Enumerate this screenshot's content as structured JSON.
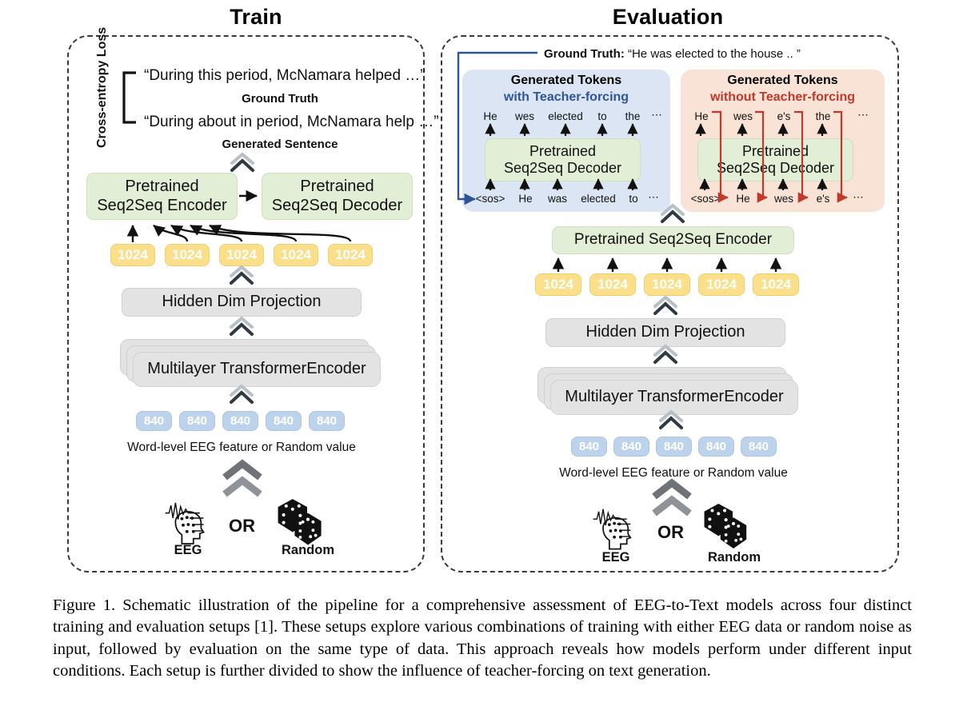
{
  "figure": {
    "caption": "Figure 1. Schematic illustration of the pipeline for a comprehensive assessment of EEG-to-Text models across four distinct training and evaluation setups [1]. These setups explore various combinations of training with either EEG data or random noise as input, followed by evaluation on the same type of data. This approach reveals how models perform under different input conditions. Each setup is further divided to show the influence of teacher-forcing on text generation."
  },
  "colors": {
    "green_box": "#e2eed6",
    "grey_box": "#e3e3e3",
    "token_1024": "#fbdf8a",
    "token_840": "#bdd3ec",
    "teacher_forcing_panel": "#dbe5f3",
    "teacher_forcing_text": "#2f5597",
    "no_teacher_forcing_panel": "#f9e2d6",
    "no_teacher_forcing_text": "#c0392b",
    "ground_truth_arrow": "#2f5597"
  },
  "train": {
    "title": "Train",
    "loss_label": "Cross-entropy Loss",
    "ground_truth_sentence": "“During this period, McNamara helped …”",
    "ground_truth_caption": "Ground Truth",
    "generated_sentence": "“During about in period, McNamara help …”",
    "generated_caption": "Generated Sentence",
    "encoder_line1": "Pretrained",
    "encoder_line2": "Seq2Seq Encoder",
    "decoder_line1": "Pretrained",
    "decoder_line2": "Seq2Seq Decoder",
    "tokens_1024": [
      "1024",
      "1024",
      "1024",
      "1024",
      "1024"
    ],
    "hidden_projection": "Hidden Dim Projection",
    "transformer_encoder": "Multilayer TransformerEncoder",
    "tokens_840": [
      "840",
      "840",
      "840",
      "840",
      "840"
    ],
    "input_caption": "Word-level EEG feature or Random value",
    "or_label": "OR",
    "eeg_label": "EEG",
    "random_label": "Random"
  },
  "evaluation": {
    "title": "Evaluation",
    "ground_truth_prefix": "Ground Truth:",
    "ground_truth_text": "“He was elected to the house .. ”",
    "teacher_forcing": {
      "heading": "Generated Tokens",
      "subheading": "with Teacher-forcing",
      "output_tokens": [
        "He",
        "wes",
        "elected",
        "to",
        "the",
        "⋯"
      ],
      "decoder_line1": "Pretrained",
      "decoder_line2": "Seq2Seq Decoder",
      "input_tokens": [
        "<sos>",
        "He",
        "was",
        "elected",
        "to",
        "⋯"
      ]
    },
    "no_teacher_forcing": {
      "heading": "Generated Tokens",
      "subheading": "without Teacher-forcing",
      "output_tokens": [
        "He",
        "wes",
        "e's",
        "the",
        "⋯"
      ],
      "decoder_line1": "Pretrained",
      "decoder_line2": "Seq2Seq Decoder",
      "input_tokens": [
        "<sos>",
        "He",
        "wes",
        "e's",
        "⋯"
      ]
    },
    "encoder": "Pretrained Seq2Seq Encoder",
    "tokens_1024": [
      "1024",
      "1024",
      "1024",
      "1024",
      "1024"
    ],
    "hidden_projection": "Hidden Dim Projection",
    "transformer_encoder": "Multilayer TransformerEncoder",
    "tokens_840": [
      "840",
      "840",
      "840",
      "840",
      "840"
    ],
    "input_caption": "Word-level EEG feature or Random value",
    "or_label": "OR",
    "eeg_label": "EEG",
    "random_label": "Random"
  }
}
